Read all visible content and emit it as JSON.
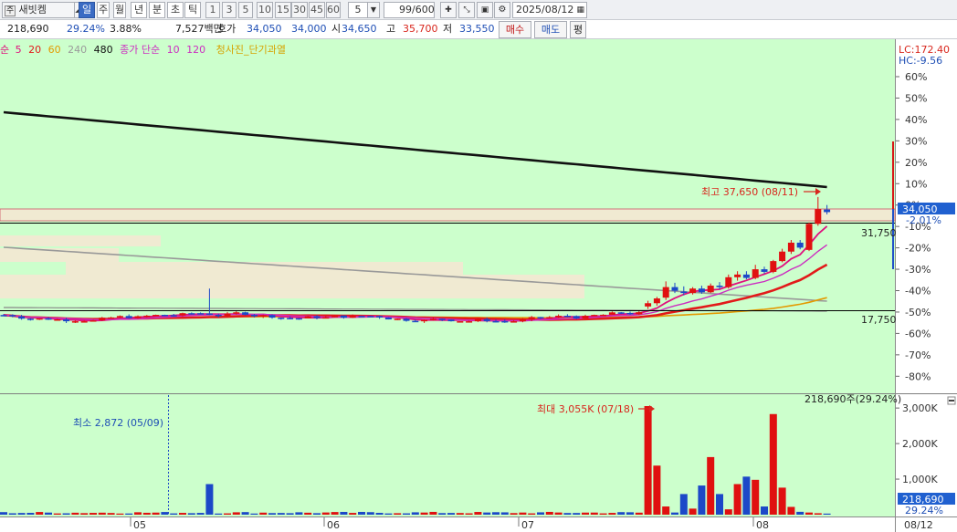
{
  "toolbar": {
    "stock_type_badge": "주",
    "stock_name": "새빗켐",
    "period_tabs": [
      "일",
      "주",
      "월",
      "년",
      "분",
      "초",
      "틱"
    ],
    "interval_buttons": [
      "1",
      "3",
      "5",
      "10",
      "15",
      "30",
      "45",
      "60"
    ],
    "interval_value": "5",
    "count_value": "99",
    "count_max": "/600",
    "date": "2025/08/12"
  },
  "quote": {
    "volume": "218,690",
    "volume_ratio": "29.24%",
    "turnover_pct": "3.88%",
    "trade_value": "7,527백만",
    "hoga_label": "호가",
    "hoga_ask": "34,050",
    "hoga_bid": "34,000",
    "open_label": "시",
    "open": "34,650",
    "high_label": "고",
    "high": "35,700",
    "low_label": "저",
    "low": "33,550",
    "buy_label": "매수",
    "sell_label": "매도",
    "eval_label": "평"
  },
  "legend": {
    "ma_prefix": "순",
    "ma": [
      {
        "label": "5",
        "color": "#e0107e"
      },
      {
        "label": "20",
        "color": "#e21a1a"
      },
      {
        "label": "60",
        "color": "#e39a00"
      },
      {
        "label": "240",
        "color": "#9a9a9a"
      },
      {
        "label": "480",
        "color": "#111111"
      }
    ],
    "vol_ma_label": "종가 단순",
    "vol_ma": [
      {
        "label": "10",
        "color": "#cc2ec1"
      },
      {
        "label": "120",
        "color": "#cc2ec1"
      }
    ],
    "indicator_label": "청사진_단기과열",
    "indicator_color": "#d6a300"
  },
  "price_scale": {
    "lc": "LC:172.40",
    "hc": "HC:-9.56",
    "ticks": [
      "60%",
      "50%",
      "40%",
      "30%",
      "20%",
      "10%",
      "0%",
      "-10%",
      "-20%",
      "-30%",
      "-40%",
      "-50%",
      "-60%",
      "-70%",
      "-80%"
    ],
    "current_price": "34,050",
    "current_change": "-2.01%",
    "level_upper": "31,750",
    "level_lower": "17,750",
    "high_annotation": "최고 37,650 (08/11)"
  },
  "volume_panel": {
    "ticks": [
      "3,000K",
      "2,000K",
      "1,000K"
    ],
    "max_annotation": "최대 3,055K (07/18)",
    "min_annotation": "최소 2,872 (05/09)",
    "current_annotation": "218,690주(29.24%)",
    "current_volume": "218,690",
    "current_ratio": "29.24%"
  },
  "x_axis": {
    "labels": [
      "05",
      "06",
      "07",
      "08"
    ],
    "last_date": "08/12"
  },
  "colors": {
    "plot_bg": "#ccffcc",
    "up": "#e01010",
    "down": "#1c48c8",
    "accent_blue": "#2060d0"
  },
  "chart_data": {
    "type": "candlestick",
    "series_ma": [
      "5",
      "20",
      "60",
      "240",
      "480"
    ],
    "recent_candles": [
      {
        "o": 18200,
        "h": 18900,
        "l": 17900,
        "c": 18600
      },
      {
        "o": 18600,
        "h": 19400,
        "l": 18300,
        "c": 19200
      },
      {
        "o": 19300,
        "h": 21500,
        "l": 19000,
        "c": 20700
      },
      {
        "o": 20700,
        "h": 21300,
        "l": 19900,
        "c": 20200
      },
      {
        "o": 20100,
        "h": 20800,
        "l": 19600,
        "c": 19900
      },
      {
        "o": 19900,
        "h": 20700,
        "l": 19700,
        "c": 20500
      },
      {
        "o": 20500,
        "h": 20900,
        "l": 19800,
        "c": 20000
      },
      {
        "o": 20000,
        "h": 21200,
        "l": 19900,
        "c": 20900
      },
      {
        "o": 20900,
        "h": 21400,
        "l": 20400,
        "c": 20700
      },
      {
        "o": 20700,
        "h": 22500,
        "l": 20500,
        "c": 22100
      },
      {
        "o": 22100,
        "h": 23000,
        "l": 21600,
        "c": 22500
      },
      {
        "o": 22500,
        "h": 23000,
        "l": 21800,
        "c": 22000
      },
      {
        "o": 22000,
        "h": 24000,
        "l": 21800,
        "c": 23300
      },
      {
        "o": 23300,
        "h": 23700,
        "l": 22600,
        "c": 22900
      },
      {
        "o": 22900,
        "h": 24800,
        "l": 22700,
        "c": 24600
      },
      {
        "o": 24600,
        "h": 26700,
        "l": 24400,
        "c": 26200
      },
      {
        "o": 26200,
        "h": 28300,
        "l": 25800,
        "c": 27800
      },
      {
        "o": 27800,
        "h": 28300,
        "l": 26600,
        "c": 26900
      },
      {
        "o": 26500,
        "h": 31800,
        "l": 26300,
        "c": 31500
      },
      {
        "o": 31500,
        "h": 37650,
        "l": 31100,
        "c": 34750
      },
      {
        "o": 34650,
        "h": 35700,
        "l": 33550,
        "c": 34050
      }
    ]
  }
}
